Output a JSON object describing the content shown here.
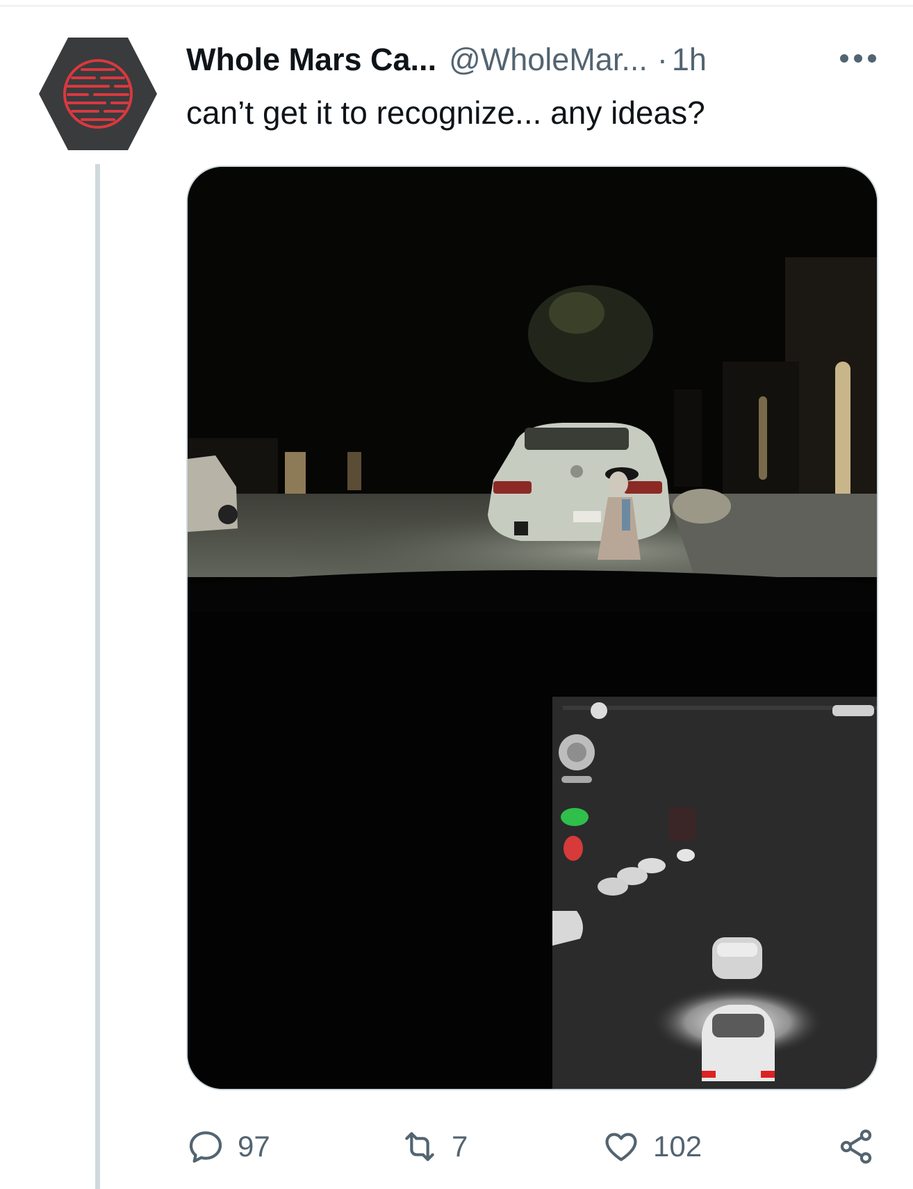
{
  "tweet": {
    "display_name": "Whole Mars Ca...",
    "handle": "@WholeMar...",
    "separator": "·",
    "time": "1h",
    "text": "can’t get it to recognize... any ideas?",
    "avatar_icon": "hexagon-globe-avatar",
    "media_alt": "night street photo with child mannequin behind parked car and dashboard screen"
  },
  "actions": {
    "reply_count": "97",
    "retweet_count": "7",
    "like_count": "102",
    "icons": [
      "reply-icon",
      "retweet-icon",
      "like-icon",
      "share-icon"
    ]
  },
  "colors": {
    "text_primary": "#0f1419",
    "text_secondary": "#536471",
    "avatar_bg": "#3a3b3d",
    "avatar_accent": "#d8393f",
    "thread_line": "#cfd9de"
  }
}
